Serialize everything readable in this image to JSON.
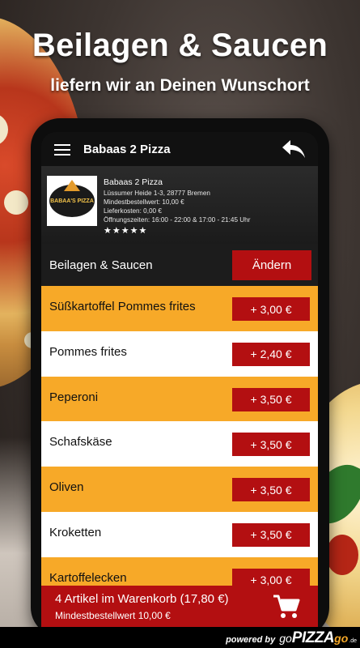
{
  "headline": "Beilagen & Saucen",
  "subline": "liefern wir an Deinen Wunschort",
  "appbar": {
    "title": "Babaas 2 Pizza"
  },
  "restaurant": {
    "logo_text": "BABAA'S PIZZA",
    "name": "Babaas 2 Pizza",
    "address": "Lüssumer Heide 1-3, 28777 Bremen",
    "min_order": "Mindestbestellwert: 10,00 €",
    "delivery_cost": "Lieferkosten: 0,00 €",
    "hours": "Öffnungszeiten: 16:00 - 22:00 & 17:00 - 21:45 Uhr",
    "stars": "★★★★★"
  },
  "category": {
    "label": "Beilagen & Saucen",
    "change_label": "Ändern"
  },
  "items": [
    {
      "name": "Süßkartoffel Pommes frites",
      "price": "+ 3,00 €"
    },
    {
      "name": "Pommes frites",
      "price": "+ 2,40 €"
    },
    {
      "name": "Peperoni",
      "price": "+ 3,50 €"
    },
    {
      "name": "Schafskäse",
      "price": "+ 3,50 €"
    },
    {
      "name": "Oliven",
      "price": "+ 3,50 €"
    },
    {
      "name": "Kroketten",
      "price": "+ 3,50 €"
    },
    {
      "name": "Kartoffelecken",
      "price": "+ 3,00 €"
    }
  ],
  "cart": {
    "summary": "4 Artikel im Warenkorb (17,80 €)",
    "min_order": "Mindestbestellwert 10,00 €"
  },
  "footer": {
    "prefix": "powered by",
    "go1": "go",
    "pizza": "PIZZA",
    "go2": "go",
    "tld": ".de"
  },
  "colors": {
    "accent_red": "#b30f11",
    "row_orange": "#f7a928",
    "row_white": "#ffffff",
    "dark": "#111111"
  },
  "icons": {
    "menu": "hamburger-menu-icon",
    "back": "back-arrow-icon",
    "cart": "shopping-cart-icon"
  }
}
